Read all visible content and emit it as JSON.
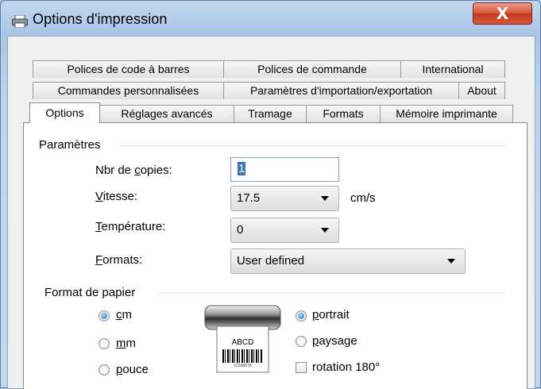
{
  "window": {
    "title": "Options d'impression",
    "close_glyph": "X"
  },
  "tabs": {
    "row1": [
      "Polices de code à barres",
      "Polices de commande",
      "International"
    ],
    "row2": [
      "Commandes personnalisées",
      "Paramètres d'importation/exportation",
      "About"
    ],
    "row3": [
      "Options",
      "Réglages avancés",
      "Tramage",
      "Formats",
      "Mémoire imprimante"
    ],
    "active": "Options"
  },
  "parametres": {
    "group_label": "Paramètres",
    "copies_label_pre": "Nbr de ",
    "copies_label_acc": "c",
    "copies_label_post": "opies:",
    "copies_value": "1",
    "vitesse_label_acc": "V",
    "vitesse_label_post": "itesse:",
    "vitesse_value": "17.5",
    "vitesse_unit": "cm/s",
    "temperature_label_acc": "T",
    "temperature_label_post": "empérature:",
    "temperature_value": "0",
    "formats_label_acc": "F",
    "formats_label_post": "ormats:",
    "formats_value": "User defined"
  },
  "format_papier": {
    "group_label": "Format de papier",
    "units": [
      {
        "acc": "c",
        "rest": "m",
        "checked": true
      },
      {
        "acc": "m",
        "rest": "m",
        "checked": false
      },
      {
        "acc": "p",
        "rest": "ouce",
        "checked": false
      }
    ],
    "orientation": [
      {
        "acc": "p",
        "rest": "ortrait",
        "checked": true
      },
      {
        "acc": "p",
        "rest": "aysage",
        "checked": false
      }
    ],
    "rotation_label": "rotation 180°",
    "rotation_checked": false,
    "label_preview": {
      "text": "ABCD",
      "barcode_number": "12345678"
    }
  },
  "colors": {
    "accent": "#1a6fc4",
    "close": "#c4381f"
  }
}
